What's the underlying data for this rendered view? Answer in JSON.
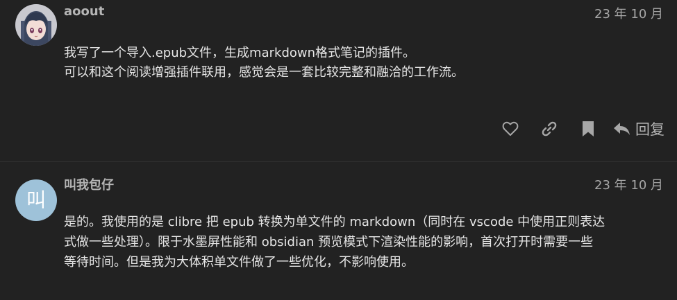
{
  "posts": [
    {
      "username": "aoout",
      "date": "23 年 10 月",
      "avatar_desc": "anime-girl-avatar",
      "lines": [
        "我写了一个导入.epub文件，生成markdown格式笔记的插件。",
        "可以和这个阅读增强插件联用，感觉会是一套比较完整和融洽的工作流。"
      ],
      "actions": {
        "like_icon": "heart-icon",
        "link_icon": "link-icon",
        "bookmark_icon": "bookmark-icon",
        "reply_icon": "reply-icon",
        "reply_label": "回复"
      }
    },
    {
      "username": "叫我包仔",
      "date": "23 年 10 月",
      "avatar_letter": "叫",
      "lines": [
        "是的。我使用的是 clibre 把 epub 转换为单文件的 markdown（同时在 vscode 中使用正则表达",
        "式做一些处理）。限于水墨屏性能和 obsidian 预览模式下渲染性能的影响，首次打开时需要一些",
        "等待时间。但是我为大体积单文件做了一些优化，不影响使用。"
      ]
    }
  ],
  "colors": {
    "background": "#222222",
    "text": "#e6e6e6",
    "muted": "#a7a7a7",
    "avatar2_bg": "#9ec2d9"
  }
}
